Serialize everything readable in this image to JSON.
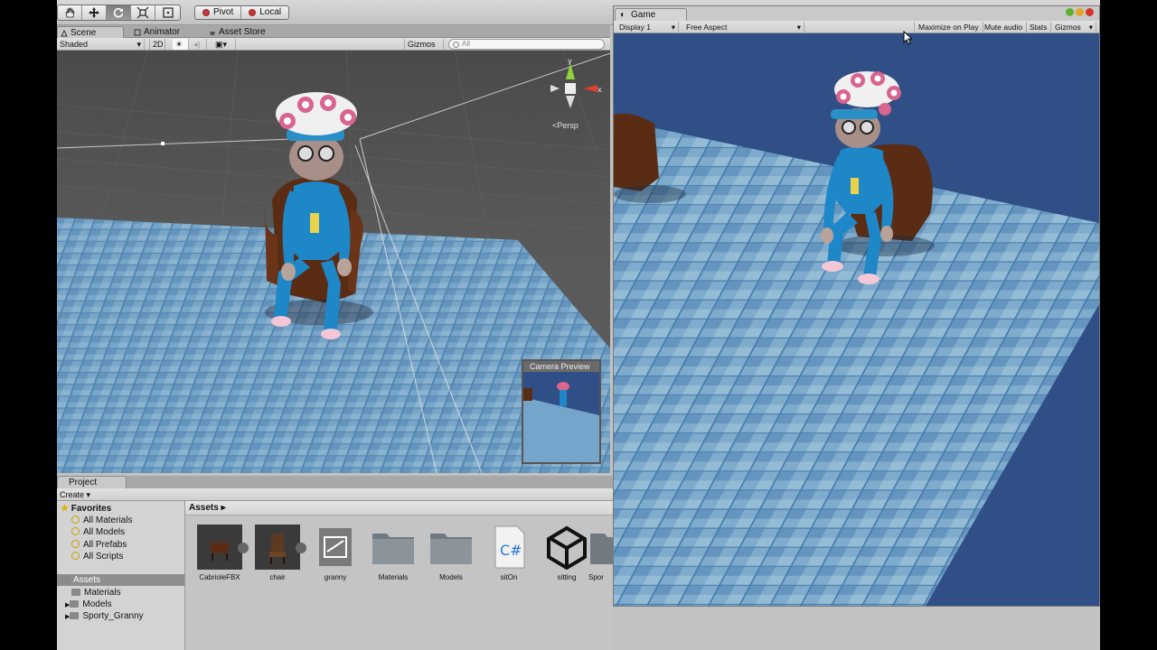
{
  "toolbar": {
    "tools": [
      "hand-tool",
      "move-tool",
      "rotate-tool",
      "scale-tool",
      "rect-tool"
    ],
    "active_tool": "rotate-tool",
    "pivot_label": "Pivot",
    "local_label": "Local"
  },
  "scene_panel": {
    "tabs": [
      {
        "label": "Scene",
        "icon": "scene-icon"
      },
      {
        "label": "Animator",
        "icon": "animator-icon"
      },
      {
        "label": "Asset Store",
        "icon": "store-icon"
      }
    ],
    "shading_mode": "Shaded",
    "mode_2d": "2D",
    "gizmos_label": "Gizmos",
    "search_placeholder": "All",
    "persp_label": "Persp",
    "gizmo_axes": {
      "y": "y",
      "x": "x"
    },
    "camera_preview_title": "Camera Preview"
  },
  "game_panel": {
    "tab_label": "Game",
    "display": "Display 1",
    "aspect": "Free Aspect",
    "maximize_on_play": "Maximize on Play",
    "mute_audio": "Mute audio",
    "stats": "Stats",
    "gizmos": "Gizmos",
    "background_color": "#2f4f86"
  },
  "project_panel": {
    "tab_label": "Project",
    "create_label": "Create",
    "favorites_label": "Favorites",
    "favorites": [
      "All Materials",
      "All Models",
      "All Prefabs",
      "All Scripts"
    ],
    "assets_label": "Assets",
    "asset_folders": [
      "Materials",
      "Models",
      "Sporty_Granny"
    ],
    "breadcrumb": "Assets",
    "items": [
      {
        "label": "CabrioleFBX",
        "icon": "model-icon"
      },
      {
        "label": "chair",
        "icon": "model-icon"
      },
      {
        "label": "granny",
        "icon": "prefab-icon"
      },
      {
        "label": "Materials",
        "icon": "folder-icon"
      },
      {
        "label": "Models",
        "icon": "folder-icon"
      },
      {
        "label": "sitOn",
        "icon": "csharp-script-icon"
      },
      {
        "label": "sitting",
        "icon": "unity-logo-icon"
      },
      {
        "label": "Spor",
        "icon": "folder-icon"
      }
    ]
  }
}
